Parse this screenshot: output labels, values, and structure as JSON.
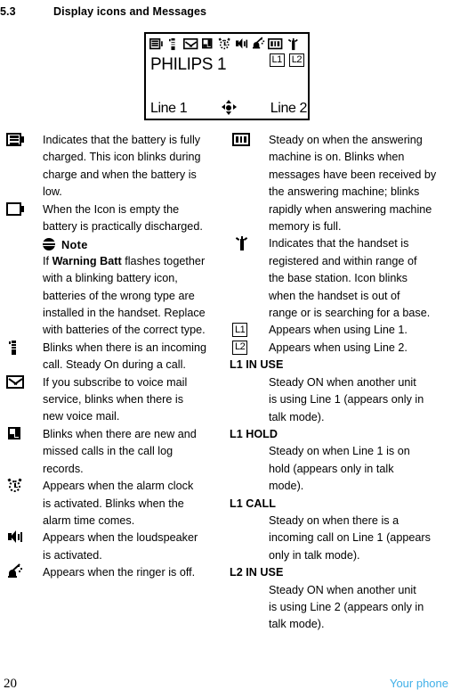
{
  "heading": {
    "number": "5.3",
    "title": "Display icons and Messages"
  },
  "lcd": {
    "handset_name": "PHILIPS 1",
    "line_flags": [
      "L1",
      "L2"
    ],
    "softkey_left": "Line 1",
    "softkey_right": "Line 2",
    "nav_icon": "four-way-navigation-icon",
    "status_icons": [
      "menu-list-icon",
      "handset-in-call-icon",
      "voicemail-envelope-icon",
      "missed-call-log-icon",
      "alarm-clock-icon",
      "loudspeaker-icon",
      "ringer-off-icon",
      "answering-machine-icon",
      "base-antenna-icon"
    ]
  },
  "left_column": [
    {
      "icon": "battery-full-icon",
      "lines": [
        "Indicates that the battery is fully",
        "charged. This icon blinks during",
        "charge and when the battery is",
        "low."
      ]
    },
    {
      "icon": "battery-empty-icon",
      "lines": [
        "When the Icon is empty the",
        "battery is practically discharged."
      ]
    },
    {
      "icon": "handset-in-call-icon",
      "lines": [
        "Blinks when there is an incoming",
        "call. Steady On during a call."
      ]
    },
    {
      "icon": "voicemail-envelope-icon",
      "lines": [
        "If you subscribe to voice mail",
        "service, blinks when there is",
        "new voice mail."
      ]
    },
    {
      "icon": "missed-call-log-icon",
      "lines": [
        "Blinks when there are new and",
        "missed calls in the call log",
        "records."
      ]
    },
    {
      "icon": "alarm-clock-icon",
      "lines": [
        "Appears when the alarm clock",
        "is activated. Blinks when the",
        "alarm time comes."
      ]
    },
    {
      "icon": "loudspeaker-icon",
      "lines": [
        "Appears when the loudspeaker",
        "is activated."
      ]
    },
    {
      "icon": "ringer-off-icon",
      "lines": [
        "Appears when the ringer is off."
      ]
    }
  ],
  "note": {
    "icon": "note-icon",
    "label": "Note",
    "line1_prefix": "If ",
    "line1_bold": "Warning Batt",
    "line1_suffix": " flashes together",
    "lines": [
      "with a blinking battery icon,",
      "batteries of the wrong type are",
      "installed in the handset. Replace",
      "with batteries of the correct type."
    ]
  },
  "right_column": [
    {
      "icon": "answering-machine-icon",
      "lines": [
        "Steady on when the answering",
        "machine is on. Blinks when",
        "messages have been received by",
        "the answering machine; blinks",
        "rapidly when answering machine",
        "memory is full."
      ]
    },
    {
      "icon": "base-antenna-icon",
      "lines": [
        "Indicates that the handset is",
        "registered and within range of",
        "the base station. Icon blinks",
        "when the handset is out of",
        "range or is searching for a base."
      ]
    },
    {
      "icon": "line-1-chip",
      "chip": "L1",
      "lines": [
        "Appears when using Line 1."
      ]
    },
    {
      "icon": "line-2-chip",
      "chip": "L2",
      "lines": [
        "Appears when using Line 2."
      ]
    }
  ],
  "messages": [
    {
      "name": "L1 IN USE",
      "lines": [
        "Steady ON when another unit",
        "is using Line 1 (appears only in",
        "talk mode)."
      ]
    },
    {
      "name": "L1 HOLD",
      "lines": [
        "Steady on when Line 1 is on",
        "hold (appears only in talk",
        "mode)."
      ]
    },
    {
      "name": "L1 CALL",
      "lines": [
        "Steady on when there is a",
        "incoming call on Line 1 (appears",
        "only in talk mode)."
      ]
    },
    {
      "name": "L2 IN USE",
      "lines": [
        "Steady ON when another unit",
        "is using Line 2 (appears only in",
        "talk mode)."
      ]
    }
  ],
  "footer": {
    "page_number": "20",
    "chapter": "Your phone",
    "chapter_color": "#41b0e8"
  }
}
